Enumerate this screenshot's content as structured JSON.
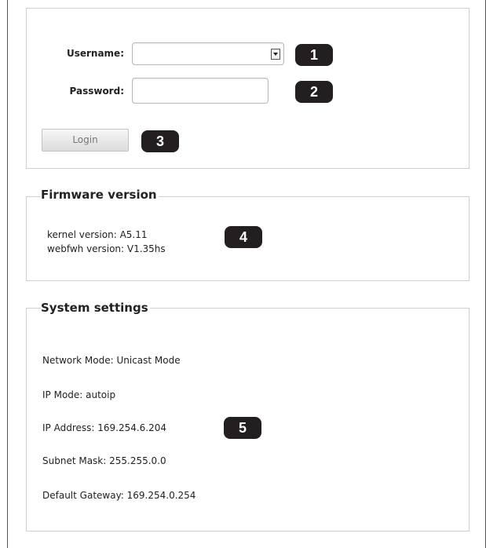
{
  "login": {
    "username_label": "Username:",
    "password_label": "Password:",
    "username_value": "",
    "password_value": "",
    "login_button": "Login"
  },
  "firmware": {
    "legend": "Firmware version",
    "kernel": "kernel version: A5.11",
    "webfwh": "webfwh version: V1.35hs"
  },
  "system": {
    "legend": "System settings",
    "network_mode": "Network Mode: Unicast Mode",
    "ip_mode": "IP Mode: autoip",
    "ip_address": "IP Address: 169.254.6.204",
    "subnet_mask": "Subnet Mask: 255.255.0.0",
    "default_gateway": "Default Gateway: 169.254.0.254"
  },
  "callouts": [
    "1",
    "2",
    "3",
    "4",
    "5"
  ],
  "colors": {
    "callout_bg": "#231f20",
    "panel_border": "#cfcfcf"
  }
}
